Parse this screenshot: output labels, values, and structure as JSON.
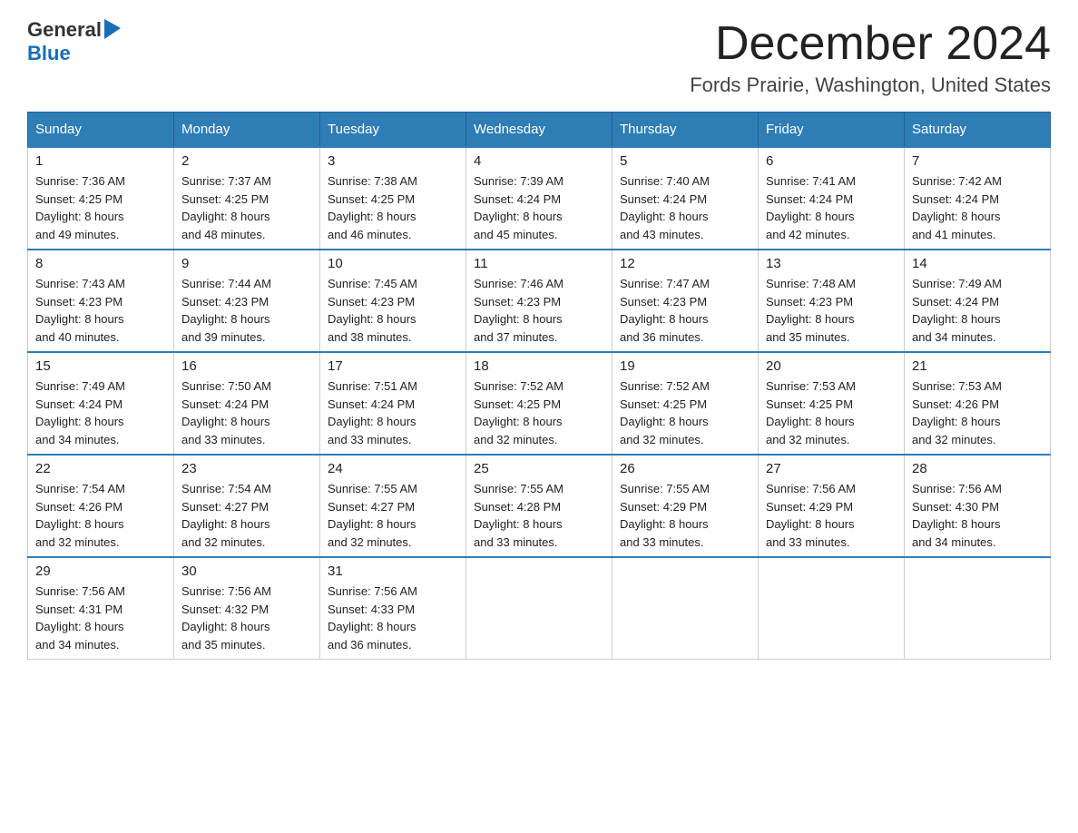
{
  "header": {
    "logo_general": "General",
    "logo_blue": "Blue",
    "month_title": "December 2024",
    "location": "Fords Prairie, Washington, United States"
  },
  "weekdays": [
    "Sunday",
    "Monday",
    "Tuesday",
    "Wednesday",
    "Thursday",
    "Friday",
    "Saturday"
  ],
  "weeks": [
    [
      {
        "day": "1",
        "sunrise": "7:36 AM",
        "sunset": "4:25 PM",
        "daylight": "8 hours and 49 minutes."
      },
      {
        "day": "2",
        "sunrise": "7:37 AM",
        "sunset": "4:25 PM",
        "daylight": "8 hours and 48 minutes."
      },
      {
        "day": "3",
        "sunrise": "7:38 AM",
        "sunset": "4:25 PM",
        "daylight": "8 hours and 46 minutes."
      },
      {
        "day": "4",
        "sunrise": "7:39 AM",
        "sunset": "4:24 PM",
        "daylight": "8 hours and 45 minutes."
      },
      {
        "day": "5",
        "sunrise": "7:40 AM",
        "sunset": "4:24 PM",
        "daylight": "8 hours and 43 minutes."
      },
      {
        "day": "6",
        "sunrise": "7:41 AM",
        "sunset": "4:24 PM",
        "daylight": "8 hours and 42 minutes."
      },
      {
        "day": "7",
        "sunrise": "7:42 AM",
        "sunset": "4:24 PM",
        "daylight": "8 hours and 41 minutes."
      }
    ],
    [
      {
        "day": "8",
        "sunrise": "7:43 AM",
        "sunset": "4:23 PM",
        "daylight": "8 hours and 40 minutes."
      },
      {
        "day": "9",
        "sunrise": "7:44 AM",
        "sunset": "4:23 PM",
        "daylight": "8 hours and 39 minutes."
      },
      {
        "day": "10",
        "sunrise": "7:45 AM",
        "sunset": "4:23 PM",
        "daylight": "8 hours and 38 minutes."
      },
      {
        "day": "11",
        "sunrise": "7:46 AM",
        "sunset": "4:23 PM",
        "daylight": "8 hours and 37 minutes."
      },
      {
        "day": "12",
        "sunrise": "7:47 AM",
        "sunset": "4:23 PM",
        "daylight": "8 hours and 36 minutes."
      },
      {
        "day": "13",
        "sunrise": "7:48 AM",
        "sunset": "4:23 PM",
        "daylight": "8 hours and 35 minutes."
      },
      {
        "day": "14",
        "sunrise": "7:49 AM",
        "sunset": "4:24 PM",
        "daylight": "8 hours and 34 minutes."
      }
    ],
    [
      {
        "day": "15",
        "sunrise": "7:49 AM",
        "sunset": "4:24 PM",
        "daylight": "8 hours and 34 minutes."
      },
      {
        "day": "16",
        "sunrise": "7:50 AM",
        "sunset": "4:24 PM",
        "daylight": "8 hours and 33 minutes."
      },
      {
        "day": "17",
        "sunrise": "7:51 AM",
        "sunset": "4:24 PM",
        "daylight": "8 hours and 33 minutes."
      },
      {
        "day": "18",
        "sunrise": "7:52 AM",
        "sunset": "4:25 PM",
        "daylight": "8 hours and 32 minutes."
      },
      {
        "day": "19",
        "sunrise": "7:52 AM",
        "sunset": "4:25 PM",
        "daylight": "8 hours and 32 minutes."
      },
      {
        "day": "20",
        "sunrise": "7:53 AM",
        "sunset": "4:25 PM",
        "daylight": "8 hours and 32 minutes."
      },
      {
        "day": "21",
        "sunrise": "7:53 AM",
        "sunset": "4:26 PM",
        "daylight": "8 hours and 32 minutes."
      }
    ],
    [
      {
        "day": "22",
        "sunrise": "7:54 AM",
        "sunset": "4:26 PM",
        "daylight": "8 hours and 32 minutes."
      },
      {
        "day": "23",
        "sunrise": "7:54 AM",
        "sunset": "4:27 PM",
        "daylight": "8 hours and 32 minutes."
      },
      {
        "day": "24",
        "sunrise": "7:55 AM",
        "sunset": "4:27 PM",
        "daylight": "8 hours and 32 minutes."
      },
      {
        "day": "25",
        "sunrise": "7:55 AM",
        "sunset": "4:28 PM",
        "daylight": "8 hours and 33 minutes."
      },
      {
        "day": "26",
        "sunrise": "7:55 AM",
        "sunset": "4:29 PM",
        "daylight": "8 hours and 33 minutes."
      },
      {
        "day": "27",
        "sunrise": "7:56 AM",
        "sunset": "4:29 PM",
        "daylight": "8 hours and 33 minutes."
      },
      {
        "day": "28",
        "sunrise": "7:56 AM",
        "sunset": "4:30 PM",
        "daylight": "8 hours and 34 minutes."
      }
    ],
    [
      {
        "day": "29",
        "sunrise": "7:56 AM",
        "sunset": "4:31 PM",
        "daylight": "8 hours and 34 minutes."
      },
      {
        "day": "30",
        "sunrise": "7:56 AM",
        "sunset": "4:32 PM",
        "daylight": "8 hours and 35 minutes."
      },
      {
        "day": "31",
        "sunrise": "7:56 AM",
        "sunset": "4:33 PM",
        "daylight": "8 hours and 36 minutes."
      },
      null,
      null,
      null,
      null
    ]
  ],
  "labels": {
    "sunrise_prefix": "Sunrise: ",
    "sunset_prefix": "Sunset: ",
    "daylight_prefix": "Daylight: "
  }
}
